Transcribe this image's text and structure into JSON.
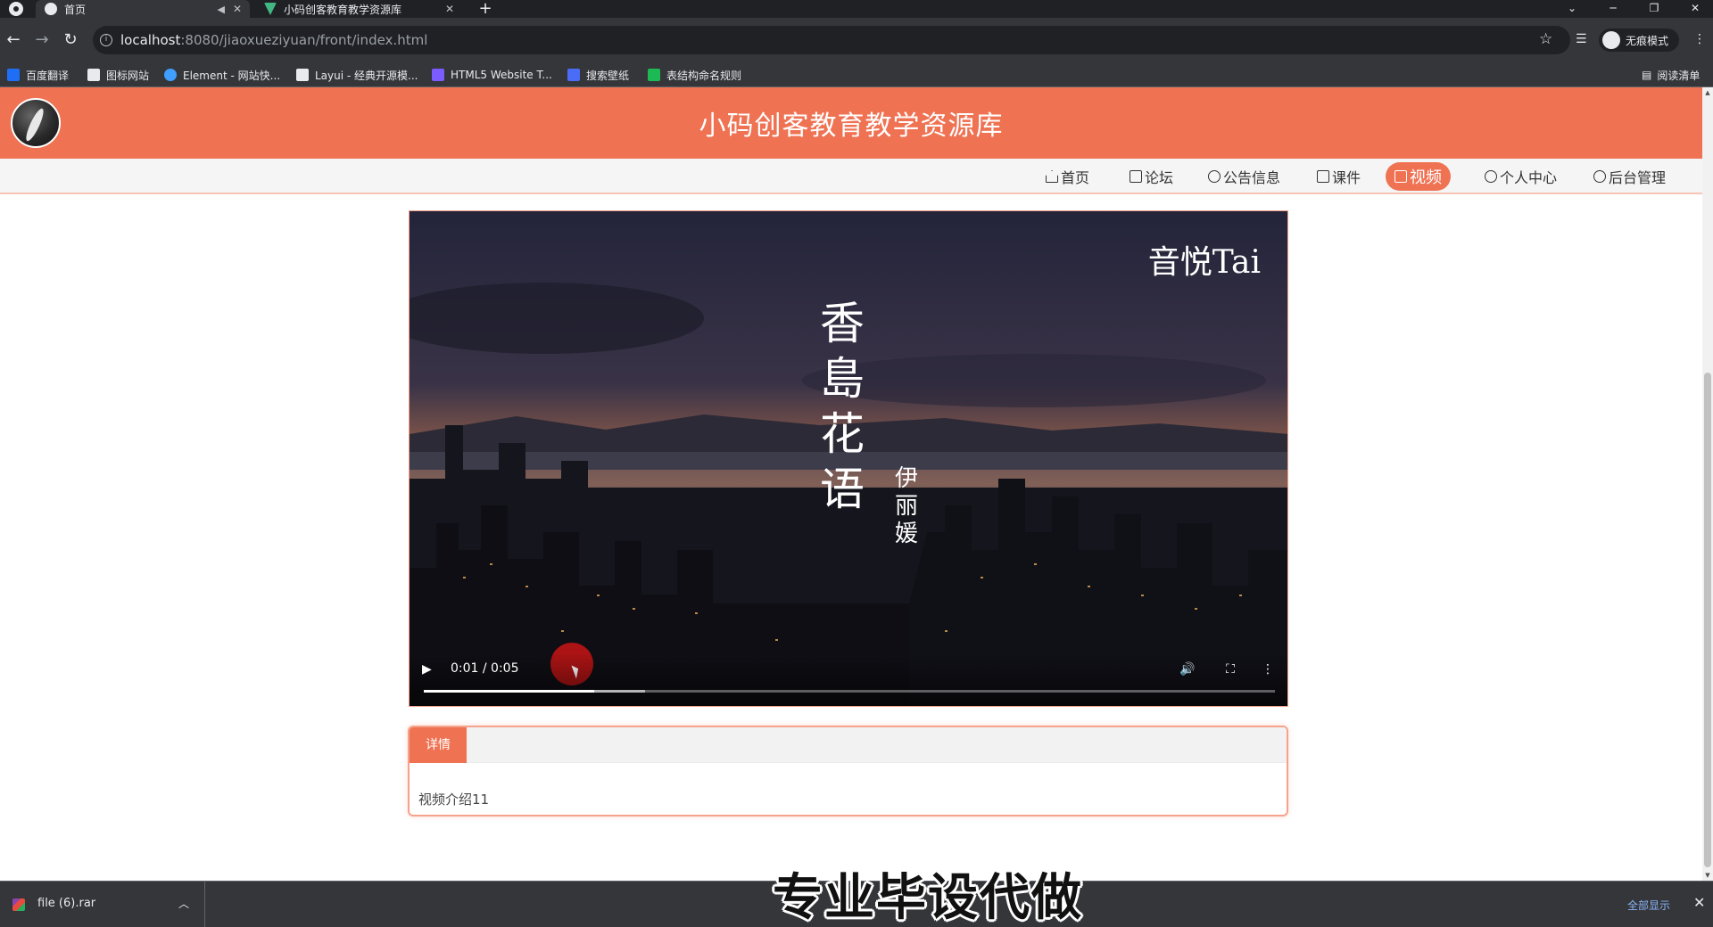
{
  "browser": {
    "tabs": [
      {
        "title": "首页",
        "active": true
      },
      {
        "title": "小码创客教育教学资源库",
        "active": false
      }
    ],
    "url_host": "localhost",
    "url_path": ":8080/jiaoxueziyuan/front/index.html",
    "incognito_label": "无痕模式",
    "bookmarks": [
      {
        "label": "百度翻译",
        "color": "#1e6ff5"
      },
      {
        "label": "图标网站",
        "color": "#e8eaed"
      },
      {
        "label": "Element - 网站快...",
        "color": "#409eff"
      },
      {
        "label": "Layui - 经典开源模...",
        "color": "#e8eaed"
      },
      {
        "label": "HTML5 Website T...",
        "color": "#7b5cff"
      },
      {
        "label": "搜索壁纸",
        "color": "#4a6cf7"
      },
      {
        "label": "表结构命名规则",
        "color": "#1db954"
      }
    ],
    "reading_list_label": "阅读清单",
    "download": {
      "filename": "file (6).rar",
      "show_all": "全部显示"
    }
  },
  "site": {
    "title": "小码创客教育教学资源库",
    "accent_color": "#ef7253",
    "nav": [
      {
        "label": "首页",
        "icon": "home-icon",
        "active": false
      },
      {
        "label": "论坛",
        "icon": "forum-icon",
        "active": false
      },
      {
        "label": "公告信息",
        "icon": "notice-icon",
        "active": false
      },
      {
        "label": "课件",
        "icon": "layers-icon",
        "active": false
      },
      {
        "label": "视频",
        "icon": "video-icon",
        "active": true
      },
      {
        "label": "个人中心",
        "icon": "user-icon",
        "active": false
      },
      {
        "label": "后台管理",
        "icon": "link-icon",
        "active": false
      }
    ]
  },
  "video": {
    "watermark": "音悦Tai",
    "title_overlay": "香島花语",
    "artist_overlay": "伊丽媛",
    "time": "0:01 / 0:05",
    "played_fraction": 0.2,
    "buffered_fraction": 0.26
  },
  "detail": {
    "tab_label": "详情",
    "body": "视频介绍11"
  },
  "overlay_caption": "专业毕设代做"
}
